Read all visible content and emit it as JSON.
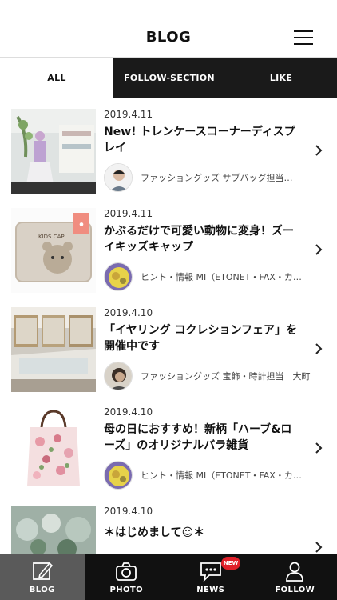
{
  "header": {
    "title": "BLOG",
    "menu_icon": "hamburger-menu-icon"
  },
  "tabs": [
    {
      "label": "ALL"
    },
    {
      "label": "FOLLOW-SECTION"
    },
    {
      "label": "LIKE"
    }
  ],
  "posts": [
    {
      "date": "2019.4.11",
      "title": "New! トレンケースコーナーディスプレイ",
      "author": "ファッショングッズ サブバッグ担当…"
    },
    {
      "date": "2019.4.11",
      "title": "かぶるだけで可愛い動物に変身！ズーイキッズキャップ",
      "author": "ヒント・情報 MI（ETONET・FAX・カ…",
      "thumb_text": "KIDS CAP"
    },
    {
      "date": "2019.4.10",
      "title": "「イヤリング コクレションフェア」を開催中です",
      "author": "ファッショングッズ 宝飾・時計担当　大町"
    },
    {
      "date": "2019.4.10",
      "title": "母の日におすすめ！新柄「ハーブ&ローズ」のオリジナルバラ雑貨",
      "author": "ヒント・情報 MI（ETONET・FAX・カ…"
    },
    {
      "date": "2019.4.10",
      "title": "＊はじめまして☺＊",
      "author": ""
    }
  ],
  "bottom_nav": [
    {
      "label": "BLOG",
      "icon": "edit-icon"
    },
    {
      "label": "PHOTO",
      "icon": "camera-icon"
    },
    {
      "label": "NEWS",
      "icon": "news-chat-icon",
      "badge": "NEW"
    },
    {
      "label": "FOLLOW",
      "icon": "person-icon"
    }
  ],
  "colors": {
    "dark": "#1a1a1a",
    "active_nav": "#5a5a5a",
    "badge": "#e0202a"
  }
}
